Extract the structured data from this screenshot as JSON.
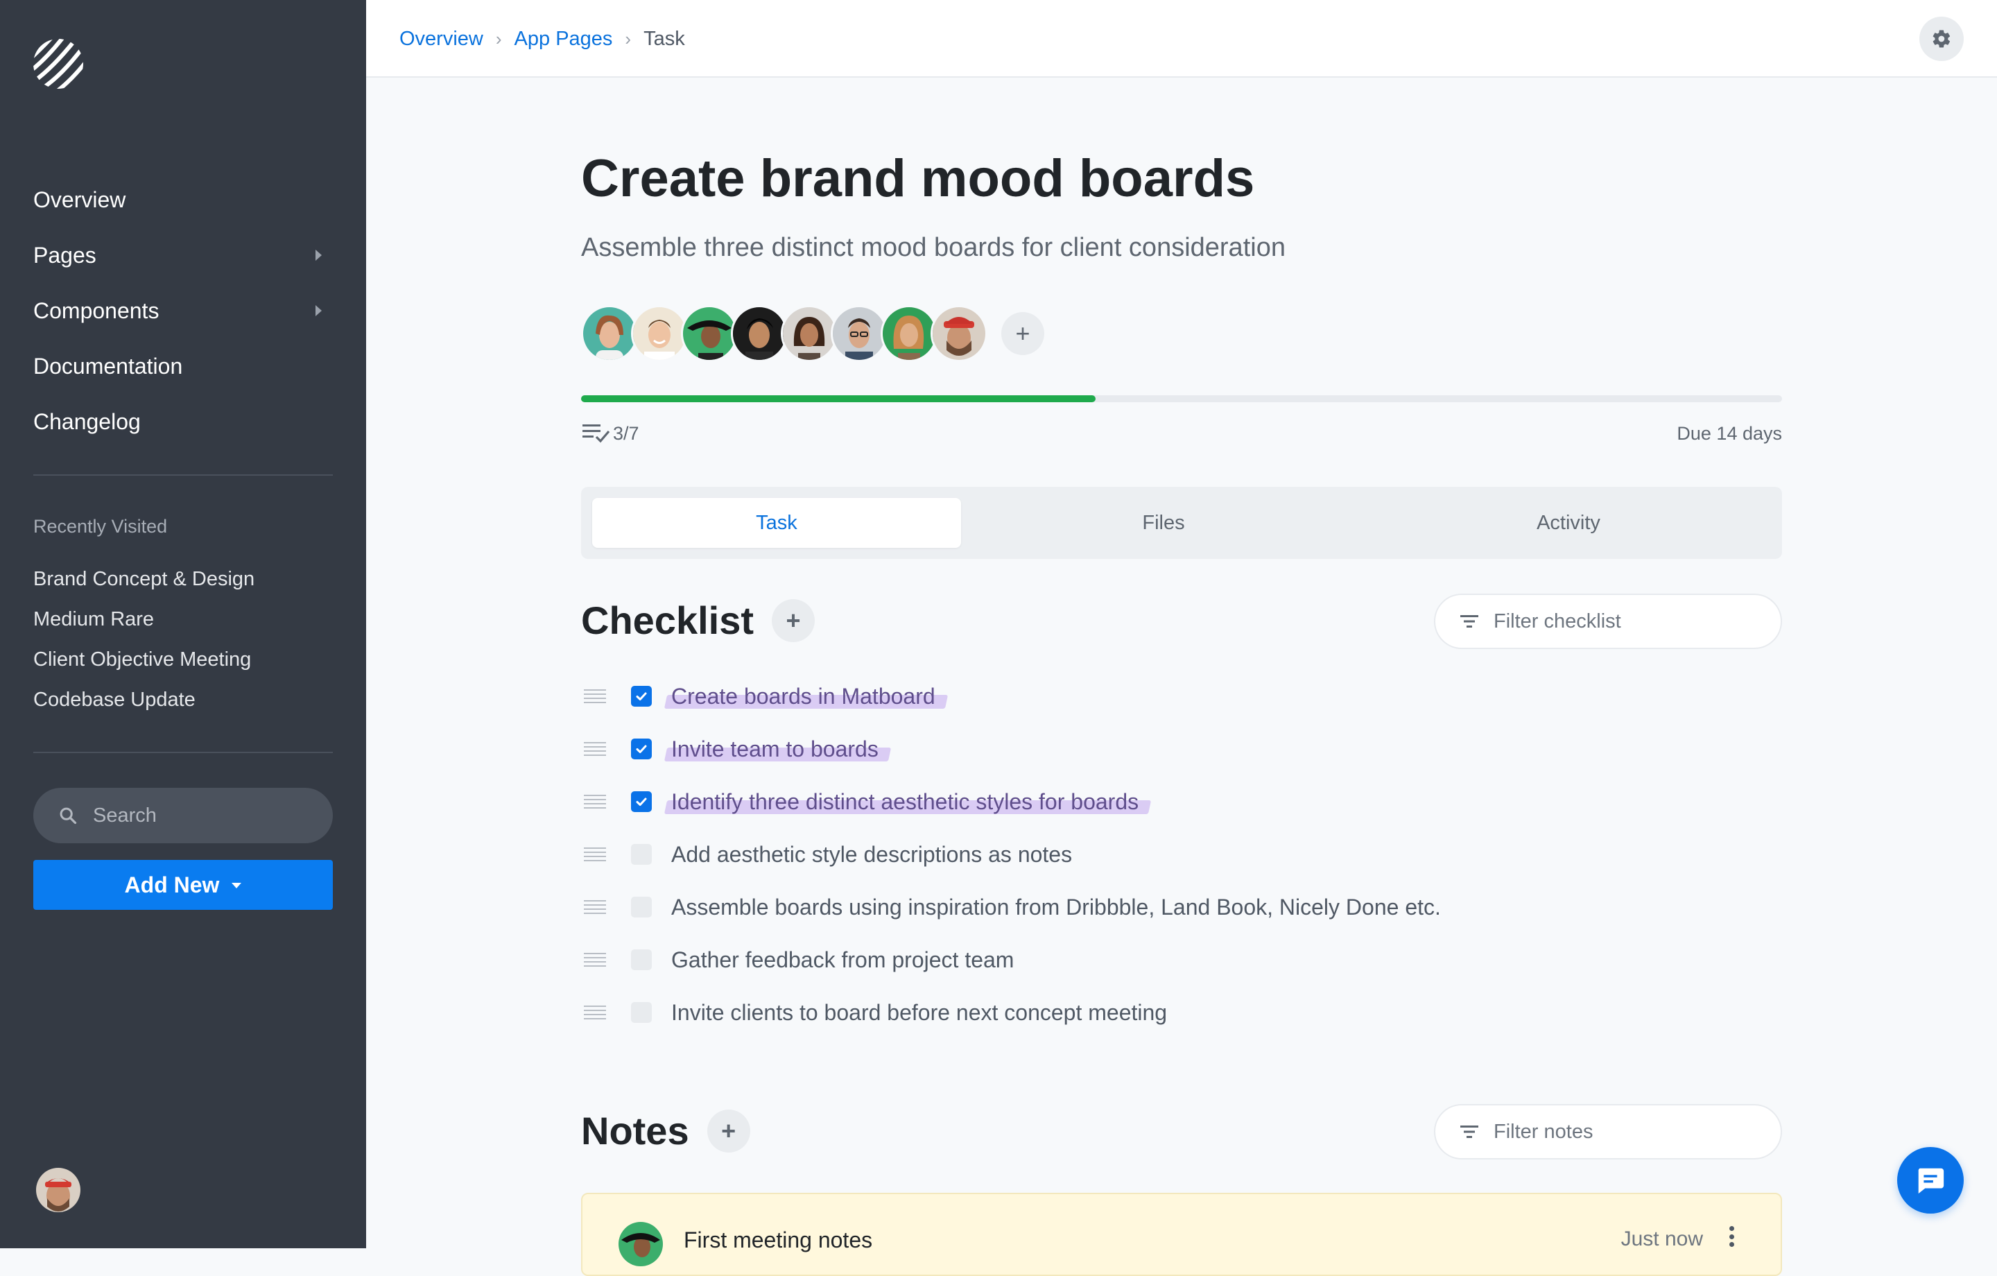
{
  "sidebar": {
    "nav": [
      {
        "label": "Overview",
        "has_submenu": false
      },
      {
        "label": "Pages",
        "has_submenu": true
      },
      {
        "label": "Components",
        "has_submenu": true
      },
      {
        "label": "Documentation",
        "has_submenu": false
      },
      {
        "label": "Changelog",
        "has_submenu": false
      }
    ],
    "recent_title": "Recently Visited",
    "recent": [
      "Brand Concept & Design",
      "Medium Rare",
      "Client Objective Meeting",
      "Codebase Update"
    ],
    "search_placeholder": "Search",
    "add_new_label": "Add New"
  },
  "breadcrumb": {
    "items": [
      "Overview",
      "App Pages"
    ],
    "current": "Task"
  },
  "task": {
    "title": "Create brand mood boards",
    "subtitle": "Assemble three distinct mood boards for client consideration",
    "progress": 0.4286,
    "count": "3/7",
    "due": "Due 14 days",
    "member_count": 8
  },
  "tabs": [
    "Task",
    "Files",
    "Activity"
  ],
  "active_tab": "Task",
  "checklist": {
    "title": "Checklist",
    "filter_placeholder": "Filter checklist",
    "items": [
      {
        "text": "Create boards in Matboard",
        "done": true
      },
      {
        "text": "Invite team to boards",
        "done": true
      },
      {
        "text": "Identify three distinct aesthetic styles for boards",
        "done": true
      },
      {
        "text": "Add aesthetic style descriptions as notes",
        "done": false
      },
      {
        "text": "Assemble boards using inspiration from Dribbble, Land Book, Nicely Done etc.",
        "done": false
      },
      {
        "text": "Gather feedback from project team",
        "done": false
      },
      {
        "text": "Invite clients to board before next concept meeting",
        "done": false
      }
    ]
  },
  "notes": {
    "title": "Notes",
    "filter_placeholder": "Filter notes",
    "items": [
      {
        "title": "First meeting notes",
        "time": "Just now"
      }
    ]
  },
  "colors": {
    "accent": "#0a72dd",
    "primary_button": "#0a7cf0",
    "progress": "#1faa4c",
    "sidebar": "#343a44",
    "highlight": "#b694ec"
  }
}
